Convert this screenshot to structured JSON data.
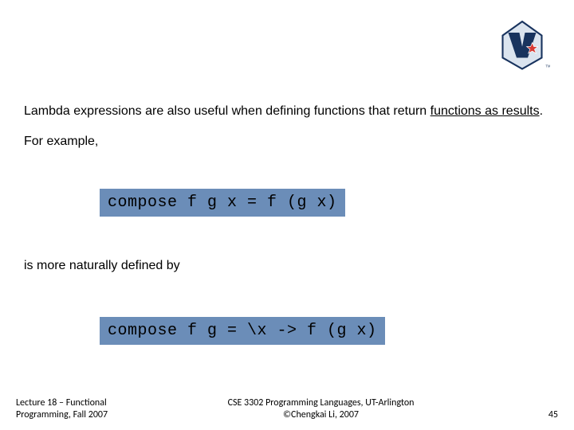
{
  "body": {
    "line1_plain": "Lambda expressions are also useful when defining functions that return ",
    "line1_underlined": "functions as results",
    "line1_period": ".",
    "for_example": "For example,",
    "code1": "compose f g x = f (g x)",
    "mid": "is more naturally defined by",
    "code2": "compose f g = \\x -> f (g x)"
  },
  "footer": {
    "left_line1": "Lecture 18 – Functional",
    "left_line2": "Programming, Fall 2007",
    "center_line1": "CSE 3302 Programming Languages, UT-Arlington",
    "center_line2": "©Chengkai Li, 2007",
    "page": "45"
  },
  "logo": {
    "name": "uta-logo"
  }
}
